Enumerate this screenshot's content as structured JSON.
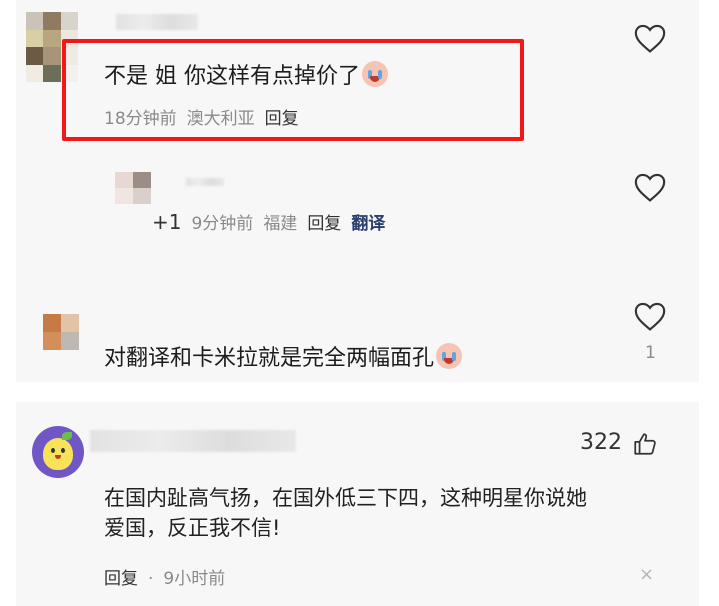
{
  "thread": {
    "comments": [
      {
        "text": "不是 姐 你这样有点掉价了",
        "emoji": "crying-laugh-emoji",
        "time": "18分钟前",
        "location": "澳大利亚",
        "reply_label": "回复"
      },
      {
        "prefix": "+1",
        "time": "9分钟前",
        "location": "福建",
        "reply_label": "回复",
        "translate_label": "翻译"
      },
      {
        "text": "对翻译和卡米拉就是完全两幅面孔",
        "emoji": "crying-laugh-emoji",
        "like_count": "1"
      }
    ]
  },
  "post": {
    "like_count": "322",
    "text_line1": "在国内趾高气扬，在国外低三下四，这种明星你说她",
    "text_line2": "爱国，反正我不信!",
    "reply_label": "回复",
    "dot": "·",
    "time": "9小时前",
    "close_glyph": "×"
  },
  "colors": {
    "highlight_border": "#f01818",
    "card_background": "#f7f7f8",
    "meta_text": "#8a8a8a",
    "translate_link": "#2a3f6e"
  }
}
